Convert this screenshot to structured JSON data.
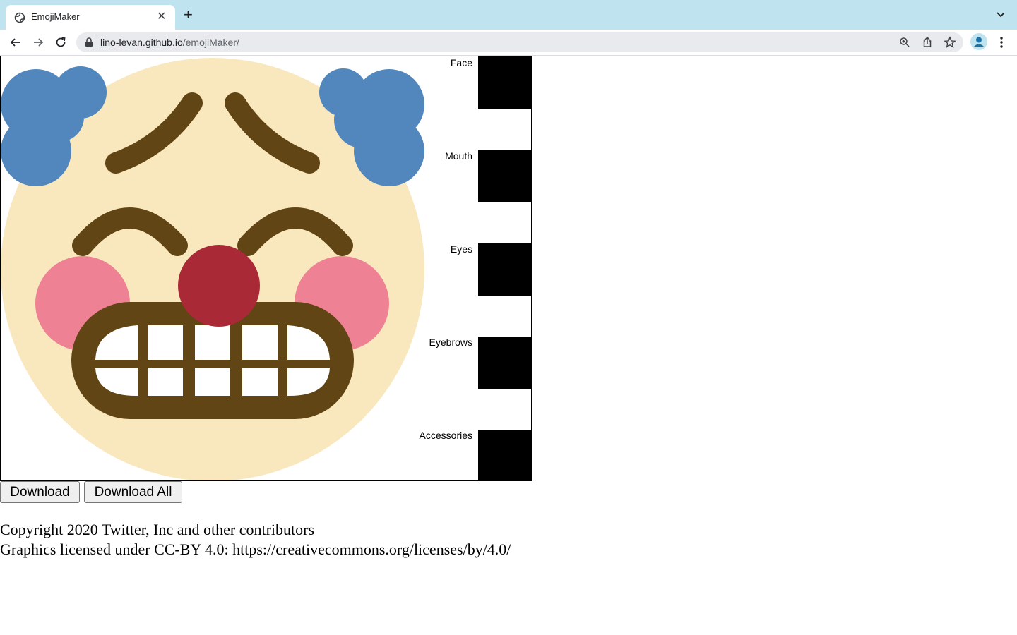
{
  "browser": {
    "tab_title": "EmojiMaker",
    "url_host": "lino-levan.github.io",
    "url_path": "/emojiMaker/"
  },
  "parts": [
    {
      "label": "Face"
    },
    {
      "label": "Mouth"
    },
    {
      "label": "Eyes"
    },
    {
      "label": "Eyebrows"
    },
    {
      "label": "Accessories"
    }
  ],
  "buttons": {
    "download": "Download",
    "download_all": "Download All"
  },
  "footer": {
    "line1": "Copyright 2020 Twitter, Inc and other contributors",
    "line2": "Graphics licensed under CC-BY 4.0: https://creativecommons.org/licenses/by/4.0/"
  },
  "colors": {
    "tabbar": "#bfe4ef",
    "face": "#f9e7bd",
    "hair": "#5287bd",
    "cheeks": "#ee8193",
    "nose": "#a92a36",
    "features": "#614514",
    "teeth": "#ffffff"
  },
  "icons": {
    "favicon": "globe-icon",
    "back": "arrow-left-icon",
    "forward": "arrow-right-icon",
    "reload": "reload-icon",
    "lock": "lock-icon",
    "zoom": "zoom-icon",
    "share": "share-icon",
    "bookmark": "star-icon",
    "profile": "person-icon",
    "menu": "kebab-menu-icon"
  }
}
